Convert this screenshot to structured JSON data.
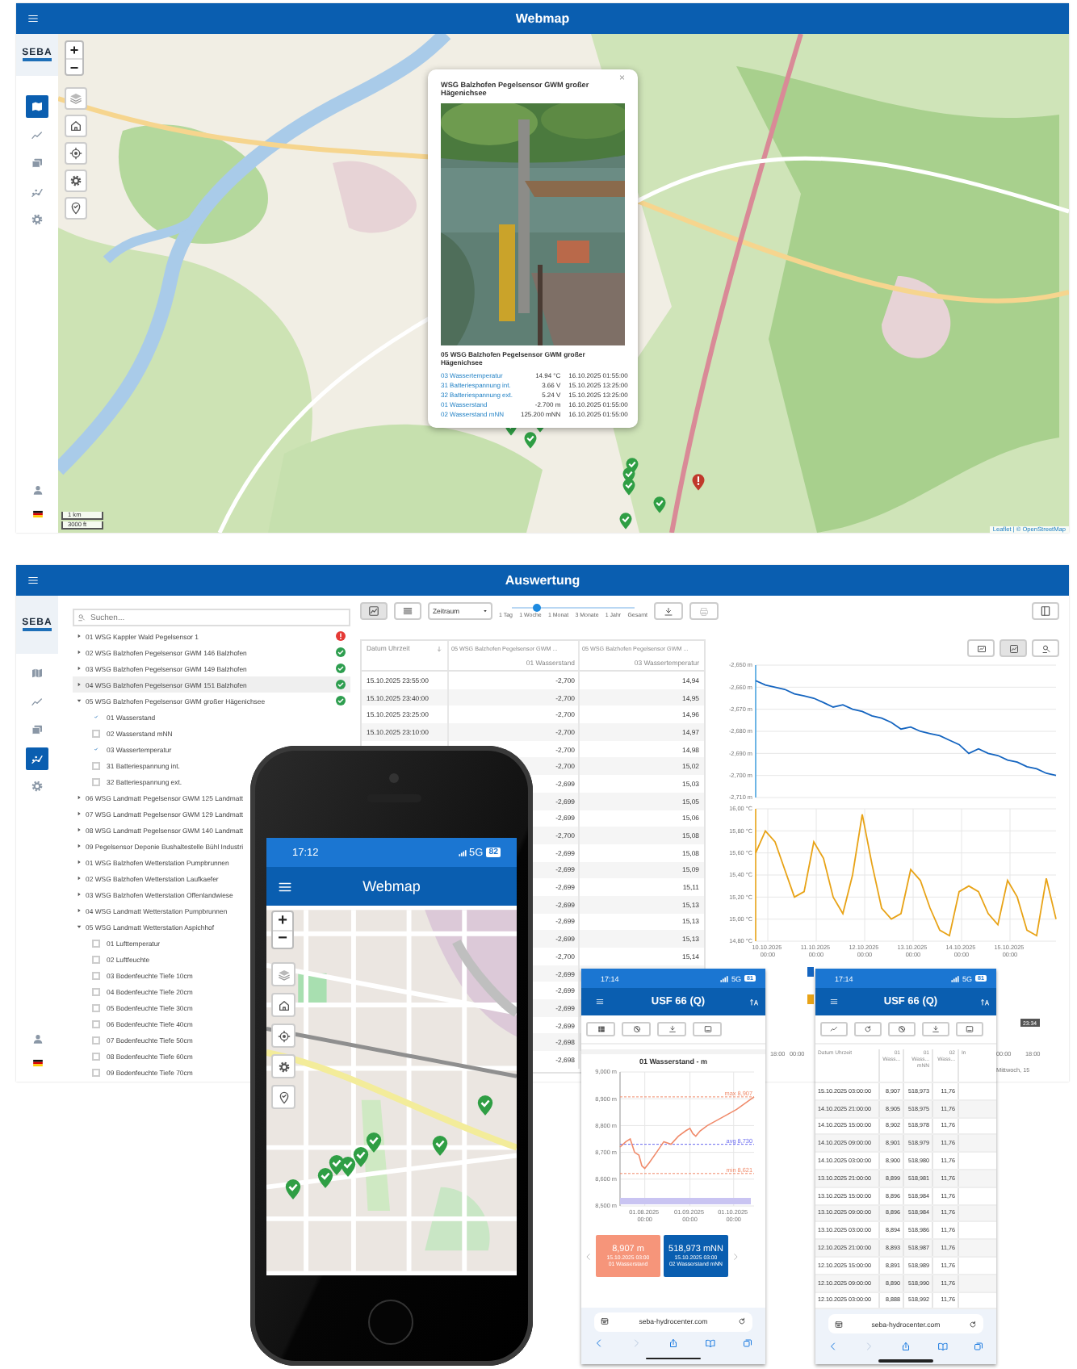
{
  "webmap": {
    "title": "Webmap",
    "logo": "SEBA",
    "nav": [
      {
        "selected": true
      },
      {
        "selected": false
      },
      {
        "selected": false
      },
      {
        "selected": false
      },
      {
        "selected": false
      }
    ],
    "zoom": [
      "+",
      "−"
    ],
    "markers": [
      {
        "kind": "ok"
      },
      {
        "kind": "ok"
      },
      {
        "kind": "ok"
      },
      {
        "kind": "ok"
      },
      {
        "kind": "ok"
      },
      {
        "kind": "ok"
      },
      {
        "kind": "ok"
      },
      {
        "kind": "ok"
      },
      {
        "kind": "alarm"
      }
    ],
    "popup": {
      "title": "WSG Balzhofen Pegelsensor GWM großer Hägenichsee",
      "close": "×",
      "subtitle": "05 WSG Balzhofen Pegelsensor GWM großer Hägenichsee",
      "rows": [
        {
          "name": "03 Wassertemperatur",
          "value": "14.94 °C",
          "time": "16.10.2025 01:55:00"
        },
        {
          "name": "31 Batteriespannung int.",
          "value": "3.66 V",
          "time": "15.10.2025 13:25:00"
        },
        {
          "name": "32 Batteriespannung ext.",
          "value": "5.24 V",
          "time": "15.10.2025 13:25:00"
        },
        {
          "name": "01 Wasserstand",
          "value": "-2.700 m",
          "time": "16.10.2025 01:55:00"
        },
        {
          "name": "02 Wasserstand mNN",
          "value": "125.200 mNN",
          "time": "16.10.2025 01:55:00"
        }
      ]
    },
    "scale": [
      "1 km",
      "3000 ft"
    ],
    "attribution": "Leaflet | © OpenStreetMap"
  },
  "analysis": {
    "title": "Auswertung",
    "logo": "SEBA",
    "nav": [
      {
        "selected": false
      },
      {
        "selected": false
      },
      {
        "selected": false
      },
      {
        "selected": true
      },
      {
        "selected": false
      }
    ],
    "search": {
      "placeholder": "Suchen..."
    },
    "tree": [
      {
        "label": "01 WSG Kappler Wald Pegelsensor 1",
        "expanded": false,
        "selected": false,
        "color": "#e53935"
      },
      {
        "label": "02 WSG Balzhofen Pegelsensor GWM 146 Balzhofen",
        "expanded": false,
        "selected": false,
        "color": "#2e9e4f"
      },
      {
        "label": "03 WSG Balzhofen Pegelsensor GWM 149 Balzhofen",
        "expanded": false,
        "selected": false,
        "color": "#2e9e4f"
      },
      {
        "label": "04 WSG Balzhofen Pegelsensor GWM 151 Balzhofen",
        "expanded": false,
        "selected": true,
        "color": "#2e9e4f"
      },
      {
        "label": "05 WSG Balzhofen Pegelsensor GWM großer Hägenichsee",
        "expanded": true,
        "selected": false,
        "color": "#2e9e4f",
        "children": [
          {
            "label": "01 Wasserstand",
            "checked": true
          },
          {
            "label": "02 Wasserstand mNN",
            "checked": false
          },
          {
            "label": "03 Wassertemperatur",
            "checked": true
          },
          {
            "label": "31 Batteriespannung int.",
            "checked": false
          },
          {
            "label": "32 Batteriespannung ext.",
            "checked": false
          }
        ]
      },
      {
        "label": "06 WSG Landmatt Pegelsensor GWM 125 Landmatt",
        "expanded": false,
        "selected": false
      },
      {
        "label": "07 WSG Landmatt Pegelsensor GWM 129 Landmatt",
        "expanded": false,
        "selected": false
      },
      {
        "label": "08 WSG Landmatt Pegelsensor GWM 140 Landmatt",
        "expanded": false,
        "selected": false
      },
      {
        "label": "09 Pegelsensor Deponie Bushaltestelle Bühl Industri",
        "expanded": false,
        "selected": false
      },
      {
        "label": "01 WSG Balzhofen Wetterstation Pumpbrunnen",
        "expanded": false,
        "selected": false
      },
      {
        "label": "02 WSG Balzhofen Wetterstation Laufkaefer",
        "expanded": false,
        "selected": false
      },
      {
        "label": "03 WSG Balzhofen Wetterstation Offenlandwiese",
        "expanded": false,
        "selected": false
      },
      {
        "label": "04 WSG Landmatt Wetterstation Pumpbrunnen",
        "expanded": false,
        "selected": false
      },
      {
        "label": "05 WSG Landmatt Wetterstation Aspichhof",
        "expanded": true,
        "selected": false,
        "children": [
          {
            "label": "01 Lufttemperatur",
            "checked": false
          },
          {
            "label": "02 Luftfeuchte",
            "checked": false
          },
          {
            "label": "03 Bodenfeuchte Tiefe 10cm",
            "checked": false
          },
          {
            "label": "04 Bodenfeuchte Tiefe 20cm",
            "checked": false
          },
          {
            "label": "05 Bodenfeuchte Tiefe 30cm",
            "checked": false
          },
          {
            "label": "06 Bodenfeuchte Tiefe 40cm",
            "checked": false
          },
          {
            "label": "07 Bodenfeuchte Tiefe 50cm",
            "checked": false
          },
          {
            "label": "08 Bodenfeuchte Tiefe 60cm",
            "checked": false
          },
          {
            "label": "09 Bodenfeuchte Tiefe 70cm",
            "checked": false
          }
        ]
      }
    ],
    "views": [
      {
        "selected": true
      },
      {
        "selected": false
      }
    ],
    "period": "Zeitraum",
    "range": {
      "level": 0.2,
      "labels": [
        "1 Tag",
        "1 Woche",
        "1 Monat",
        "3 Monate",
        "1 Jahr",
        "Gesamt"
      ]
    },
    "actions": [
      {
        "disabled": false
      },
      {
        "disabled": true
      }
    ],
    "table": {
      "columns": [
        {
          "title": "Datum Uhrzeit"
        },
        {
          "title": "05 WSG Balzhofen Pegelsensor GWM ...",
          "subtitle": "01 Wasserstand"
        },
        {
          "title": "05 WSG Balzhofen Pegelsensor GWM ...",
          "subtitle": "03 Wassertemperatur"
        }
      ],
      "rows": [
        {
          "date": "15.10.2025 23:55:00",
          "c1": "-2,700",
          "c2": "14,94"
        },
        {
          "date": "15.10.2025 23:40:00",
          "c1": "-2,700",
          "c2": "14,95"
        },
        {
          "date": "15.10.2025 23:25:00",
          "c1": "-2,700",
          "c2": "14,96"
        },
        {
          "date": "15.10.2025 23:10:00",
          "c1": "-2,700",
          "c2": "14,97"
        },
        {
          "c1": "-2,700",
          "c2": "14,98"
        },
        {
          "c1": "-2,700",
          "c2": "15,02"
        },
        {
          "c1": "-2,699",
          "c2": "15,03"
        },
        {
          "c1": "-2,699",
          "c2": "15,05"
        },
        {
          "c1": "-2,699",
          "c2": "15,06"
        },
        {
          "c1": "-2,700",
          "c2": "15,08"
        },
        {
          "c1": "-2,699",
          "c2": "15,08"
        },
        {
          "c1": "-2,699",
          "c2": "15,09"
        },
        {
          "c1": "-2,699",
          "c2": "15,11"
        },
        {
          "c1": "-2,699",
          "c2": "15,13"
        },
        {
          "c1": "-2,699",
          "c2": "15,13"
        },
        {
          "c1": "-2,699",
          "c2": "15,13"
        },
        {
          "c1": "-2,700",
          "c2": "15,14"
        },
        {
          "c1": "-2,699"
        },
        {
          "c1": "-2,699"
        },
        {
          "c1": "-2,699"
        },
        {
          "c1": "-2,699"
        },
        {
          "c1": "-2,698"
        },
        {
          "c1": "-2,698"
        }
      ]
    },
    "chart_views": [
      {
        "selected": false
      },
      {
        "selected": true
      },
      {
        "selected": false
      }
    ],
    "charts": [
      {
        "y_labels": [
          "-2,650 m",
          "-2,660 m",
          "-2,670 m",
          "-2,680 m",
          "-2,690 m",
          "-2,700 m",
          "-2,710 m"
        ]
      },
      {
        "y_labels": [
          "16,00 °C",
          "15,80 °C",
          "15,60 °C",
          "15,40 °C",
          "15,20 °C",
          "15,00 °C",
          "14,80 °C"
        ],
        "x_labels": [
          "10.10.2025 00:00",
          "11.10.2025 00:00",
          "12.10.2025 00:00",
          "13.10.2025 00:00",
          "14.10.2025 00:00",
          "15.10.2025 00:00"
        ]
      }
    ],
    "navigator": {
      "series": [
        {
          "color": "#1565c0"
        },
        {
          "color": "#e8a317"
        }
      ],
      "left_labels": [
        "18:00",
        "00:00"
      ],
      "right_labels": [
        "00:00",
        "18:00"
      ],
      "day": "Mittwoch, 15",
      "badge": "23:34"
    }
  },
  "phone": {
    "time": "17:12",
    "network": "5G",
    "battery": "82",
    "title": "Webmap",
    "zoom": [
      "+",
      "−"
    ],
    "markers": [
      {
        "kind": "ok"
      },
      {
        "kind": "ok"
      },
      {
        "kind": "ok"
      },
      {
        "kind": "ok"
      },
      {
        "kind": "ok"
      },
      {
        "kind": "ok"
      },
      {
        "kind": "ok"
      },
      {
        "kind": "ok"
      }
    ]
  },
  "mobile_chart": {
    "time": "17:14",
    "network": "5G",
    "battery": "81",
    "title": "USF 66 (Q)",
    "chart": {
      "title": "01 Wasserstand - m",
      "y_labels": [
        "9,000 m",
        "8,900 m",
        "8,800 m",
        "8,700 m",
        "8,600 m",
        "8,500 m"
      ],
      "x_labels": [
        "01.08.2025 00:00",
        "01.09.2025 00:00",
        "01.10.2025 00:00"
      ],
      "ref_lines": [
        {
          "label": "max 8,907"
        },
        {
          "label": "avg 8,730"
        },
        {
          "label": "min 8,621"
        }
      ]
    },
    "cards": [
      {
        "value": "8,907 m",
        "time": "15.10.2025 03:00",
        "label": "01 Wasserstand",
        "color": "#f6957a"
      },
      {
        "value": "518,973 mNN",
        "time": "15.10.2025 03:00",
        "label": "02 Wasserstand mNN",
        "color": "#0a5eb0"
      }
    ],
    "url": "seba-hydrocenter.com"
  },
  "mobile_table": {
    "time": "17:14",
    "network": "5G",
    "battery": "81",
    "title": "USF 66 (Q)",
    "columns": [
      "Datum Uhrzeit",
      "01 Wass...",
      "01 Wass... mNN",
      "02 Wass...",
      "In"
    ],
    "rows": [
      [
        "15.10.2025 03:00:00",
        "8,907",
        "518,973",
        "11,76"
      ],
      [
        "14.10.2025 21:00:00",
        "8,905",
        "518,975",
        "11,76"
      ],
      [
        "14.10.2025 15:00:00",
        "8,902",
        "518,978",
        "11,76"
      ],
      [
        "14.10.2025 09:00:00",
        "8,901",
        "518,979",
        "11,76"
      ],
      [
        "14.10.2025 03:00:00",
        "8,900",
        "518,980",
        "11,76"
      ],
      [
        "13.10.2025 21:00:00",
        "8,899",
        "518,981",
        "11,76"
      ],
      [
        "13.10.2025 15:00:00",
        "8,896",
        "518,984",
        "11,76"
      ],
      [
        "13.10.2025 09:00:00",
        "8,896",
        "518,984",
        "11,76"
      ],
      [
        "13.10.2025 03:00:00",
        "8,894",
        "518,986",
        "11,76"
      ],
      [
        "12.10.2025 21:00:00",
        "8,893",
        "518,987",
        "11,76"
      ],
      [
        "12.10.2025 15:00:00",
        "8,891",
        "518,989",
        "11,76"
      ],
      [
        "12.10.2025 09:00:00",
        "8,890",
        "518,990",
        "11,76"
      ],
      [
        "12.10.2025 03:00:00",
        "8,888",
        "518,992",
        "11,76"
      ]
    ],
    "url": "seba-hydrocenter.com"
  }
}
